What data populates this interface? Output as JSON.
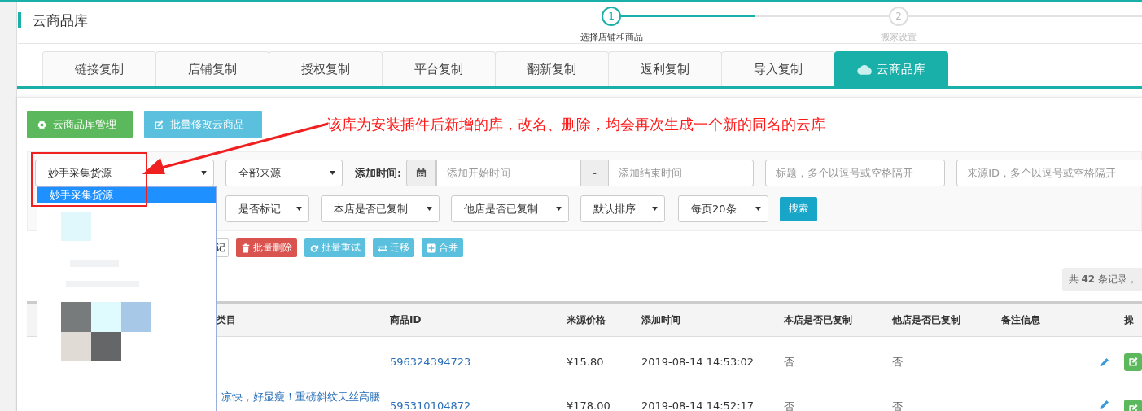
{
  "header": {
    "title": "云商品库"
  },
  "steps": [
    {
      "number": "1",
      "label": "选择店铺和商品",
      "selected": true
    },
    {
      "number": "2",
      "label": "搬家设置",
      "selected": false
    }
  ],
  "tabs": [
    {
      "label": "链接复制",
      "selected": false
    },
    {
      "label": "店铺复制",
      "selected": false
    },
    {
      "label": "授权复制",
      "selected": false
    },
    {
      "label": "平台复制",
      "selected": false
    },
    {
      "label": "翻新复制",
      "selected": false
    },
    {
      "label": "返利复制",
      "selected": false
    },
    {
      "label": "导入复制",
      "selected": false
    },
    {
      "label": "云商品库",
      "selected": true
    }
  ],
  "toolbar_buttons": [
    {
      "label": "云商品库管理",
      "kind": "manage"
    },
    {
      "label": "批量修改云商品",
      "kind": "edit"
    }
  ],
  "annotation": {
    "text": "该库为安装插件后新增的库，改名、删除，均会再次生成一个新的同名的云库"
  },
  "filters": {
    "library_select": {
      "value": "妙手采集货源",
      "options": [
        {
          "label": "妙手采集货源",
          "selected": true
        }
      ]
    },
    "source_select": "全部来源",
    "time_label": "添加时间:",
    "start_placeholder": "添加开始时间",
    "separator": "-",
    "end_placeholder": "添加结束时间",
    "title_placeholder": "标题，多个以逗号或空格隔开",
    "source_id_placeholder": "来源ID，多个以逗号或空格隔开",
    "selects": [
      "是否标记",
      "本店是否已复制",
      "他店是否已复制",
      "默认排序",
      "每页20条"
    ],
    "search_button": "搜索"
  },
  "bulk_actions": [
    {
      "label": "记",
      "kind": "plain"
    },
    {
      "label": "批量删除",
      "kind": "delete"
    },
    {
      "label": "批量重试",
      "kind": "retry"
    },
    {
      "label": "迁移",
      "kind": "move"
    },
    {
      "label": "合并",
      "kind": "merge"
    }
  ],
  "record_count": "共 **42** 条记录，",
  "table": {
    "columns": [
      "类目",
      "商品ID",
      "来源价格",
      "添加时间",
      "本店是否已复制",
      "他店是否已复制",
      "备注信息",
      "操"
    ],
    "rows": [
      {
        "product_id": "596324394723",
        "price": "¥15.80",
        "added_time": "2019-08-14 14:53:02",
        "this_store_copied": "否",
        "other_store_copied": "否"
      },
      {
        "title": "凉快，好显瘦！重磅斜纹天丝高腰",
        "product_id": "595310104872",
        "price": "¥178.00",
        "added_time": "2019-08-14 14:52:17",
        "this_store_copied": "否",
        "other_store_copied": "否"
      }
    ]
  }
}
